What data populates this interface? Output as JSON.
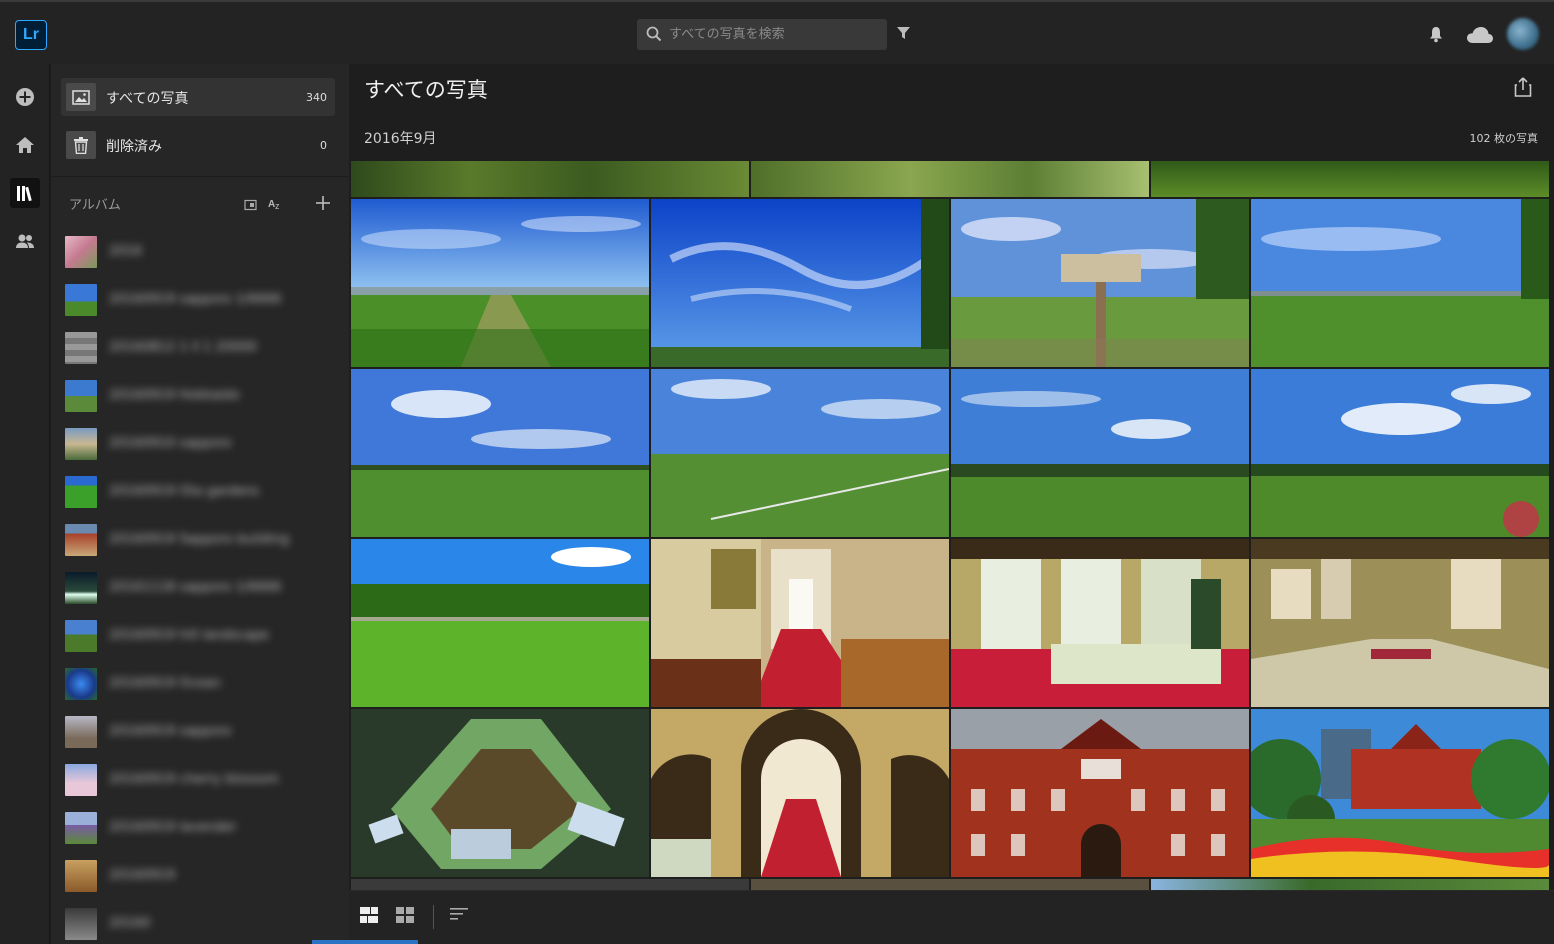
{
  "app": {
    "logo_text": "Lr",
    "accent": "#31a8ff"
  },
  "search": {
    "placeholder": "すべての写真を検索"
  },
  "header_icons": [
    "filter-icon",
    "bell-icon",
    "cloud-icon",
    "avatar"
  ],
  "rail": [
    "add-icon",
    "home-icon",
    "library-icon",
    "people-icon"
  ],
  "library": {
    "items": [
      {
        "label": "すべての写真",
        "count": "340"
      },
      {
        "label": "削除済み",
        "count": "0"
      }
    ]
  },
  "albums": {
    "heading": "アルバム",
    "items": [
      {
        "name": "2016",
        "thumb": "blossom"
      },
      {
        "name": "20160919 sapporo 1/6666",
        "thumb": "sky-field"
      },
      {
        "name": "20160812 1 ll 1 20000",
        "thumb": "gray"
      },
      {
        "name": "20160919 Hokkaido",
        "thumb": "landscape"
      },
      {
        "name": "20160910 sapporo",
        "thumb": "building"
      },
      {
        "name": "20160919 Ota gardens",
        "thumb": "green"
      },
      {
        "name": "20160919 Sapporo building",
        "thumb": "red-building"
      },
      {
        "name": "20161118 sapporo 1/6666",
        "thumb": "night"
      },
      {
        "name": "20160919 hill landscape",
        "thumb": "hill"
      },
      {
        "name": "20160919 Ocean",
        "thumb": "blue-swirl"
      },
      {
        "name": "20160919 sapporo",
        "thumb": "tree"
      },
      {
        "name": "20160919 cherry blossom",
        "thumb": "sakura"
      },
      {
        "name": "20160919 lavender",
        "thumb": "lavender"
      },
      {
        "name": "20160919",
        "thumb": "brown"
      },
      {
        "name": "20160",
        "thumb": "dark"
      }
    ]
  },
  "main": {
    "title": "すべての写真",
    "month": "2016年9月",
    "photo_count": "102 枚の写真"
  },
  "photos": [
    [
      "field-path",
      "sky-wide",
      "sign-hill",
      "field-tree"
    ],
    [
      "field-clouds",
      "field-fence",
      "field-clouds2",
      "field-flowers"
    ],
    [
      "field-forest",
      "hallway",
      "dining-room",
      "museum-room"
    ],
    [
      "exhibit-case",
      "staircase",
      "brick-building",
      "government-garden"
    ]
  ]
}
